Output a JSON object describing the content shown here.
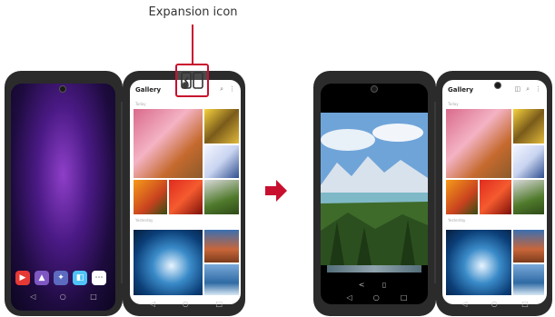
{
  "callout": {
    "label": "Expansion icon"
  },
  "gallery": {
    "title": "Gallery",
    "section1": "Today",
    "section2": "Yesterday"
  },
  "nav": {
    "back": "◁",
    "home": "○",
    "recent": "□"
  },
  "viewer_nav": {
    "share": "<",
    "delete": "▯"
  },
  "icons": {
    "dock": [
      "youtube-icon",
      "photos-icon",
      "game-icon",
      "dual-screen-icon",
      "apps-icon"
    ],
    "gallery_header": [
      "expansion-icon",
      "search-icon",
      "more-icon"
    ]
  },
  "colors": {
    "accent": "#c8102e",
    "phone": "#2b2b2b"
  }
}
